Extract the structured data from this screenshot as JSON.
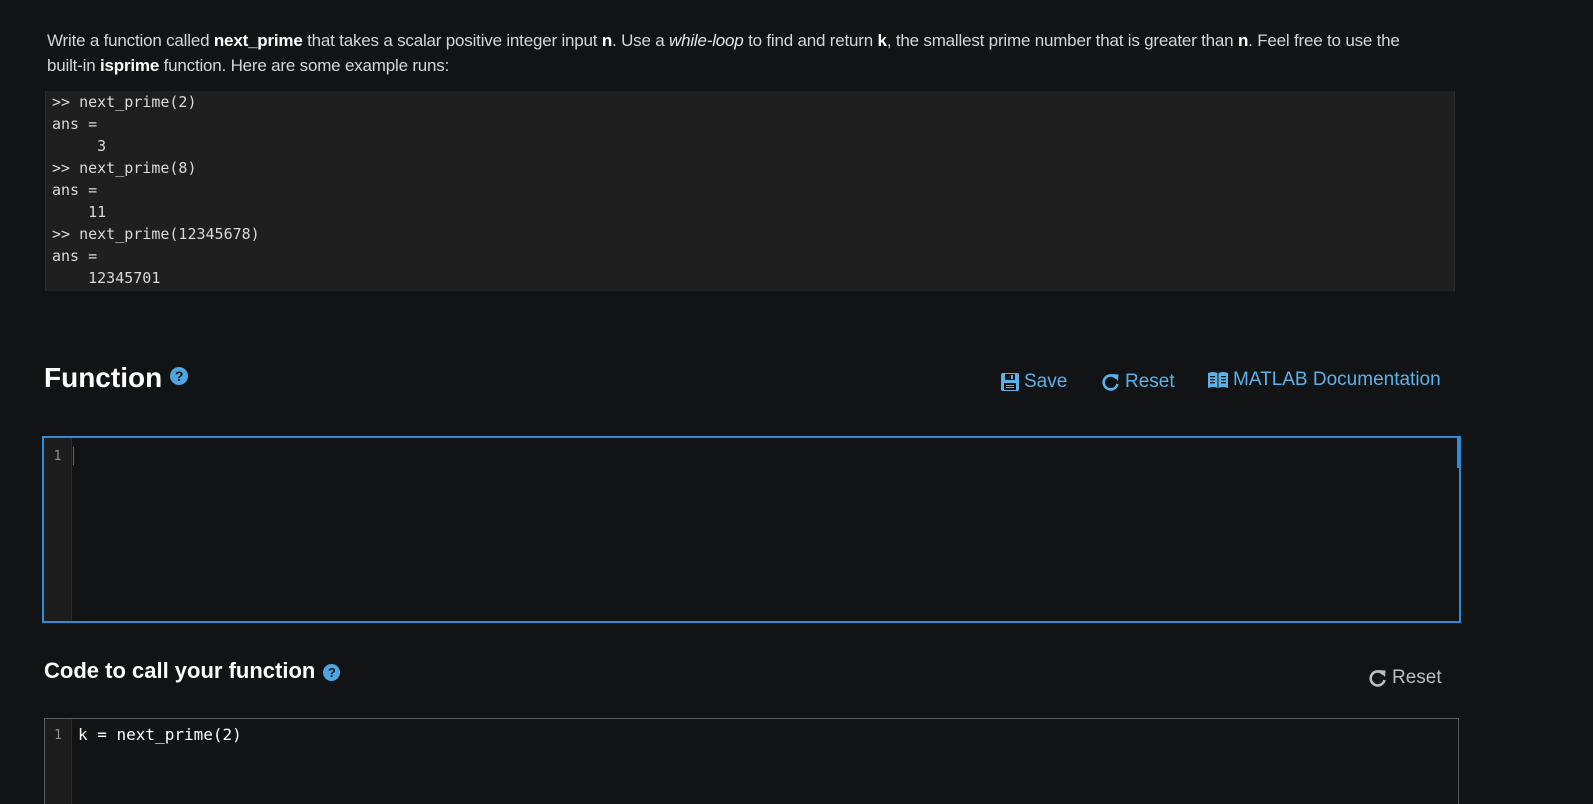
{
  "problem": {
    "p1": "Write a function called ",
    "b1": "next_prime",
    "p2": " that takes a scalar positive integer input ",
    "b2": "n",
    "p3": ". Use a ",
    "i1": "while-loop",
    "p4": " to find and return ",
    "b3": "k",
    "p5": ", the smallest prime number that is greater than ",
    "b4": "n",
    "p6": ". Feel free to use the built-in ",
    "b5": "isprime",
    "p7": " function. Here are some example runs:"
  },
  "examples": [
    ">> next_prime(2)",
    "ans =",
    "     3",
    ">> next_prime(8)",
    "ans =",
    "    11",
    ">> next_prime(12345678)",
    "ans =",
    "    12345701"
  ],
  "function_section": {
    "title": "Function",
    "help": "?",
    "save_label": "Save",
    "reset_label": "Reset",
    "docs_label": "MATLAB Documentation",
    "line_number": "1",
    "code": ""
  },
  "call_section": {
    "title": "Code to call your function",
    "help": "?",
    "reset_label": "Reset",
    "line_number": "1",
    "code": "k = next_prime(2)"
  },
  "colors": {
    "accent": "#2a8fd8",
    "link": "#5ab2ea",
    "background": "#121314"
  }
}
